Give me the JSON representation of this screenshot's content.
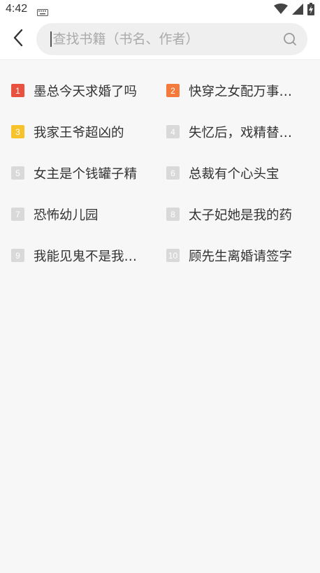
{
  "status": {
    "time": "4:42",
    "keyboard_icon": "keyboard-icon",
    "wifi_icon": "wifi-icon",
    "signal_icon": "signal-icon",
    "battery_icon": "battery-charging-icon"
  },
  "header": {
    "back_icon": "chevron-left-icon",
    "search_placeholder": "查找书籍（书名、作者）",
    "search_value": "",
    "search_icon": "search-icon"
  },
  "colors": {
    "rank1": "#e8523f",
    "rank2": "#f47b3c",
    "rank3": "#f8c22b",
    "rank_default": "#d9d9d9"
  },
  "hot_books": [
    {
      "rank": "1",
      "title": "墨总今天求婚了吗"
    },
    {
      "rank": "2",
      "title": "快穿之女配万事…"
    },
    {
      "rank": "3",
      "title": "我家王爷超凶的"
    },
    {
      "rank": "4",
      "title": "失忆后，戏精替…"
    },
    {
      "rank": "5",
      "title": "女主是个钱罐子精"
    },
    {
      "rank": "6",
      "title": "总裁有个心头宝"
    },
    {
      "rank": "7",
      "title": "恐怖幼儿园"
    },
    {
      "rank": "8",
      "title": "太子妃她是我的药"
    },
    {
      "rank": "9",
      "title": "我能见鬼不是我…"
    },
    {
      "rank": "10",
      "title": "顾先生离婚请签字"
    }
  ]
}
